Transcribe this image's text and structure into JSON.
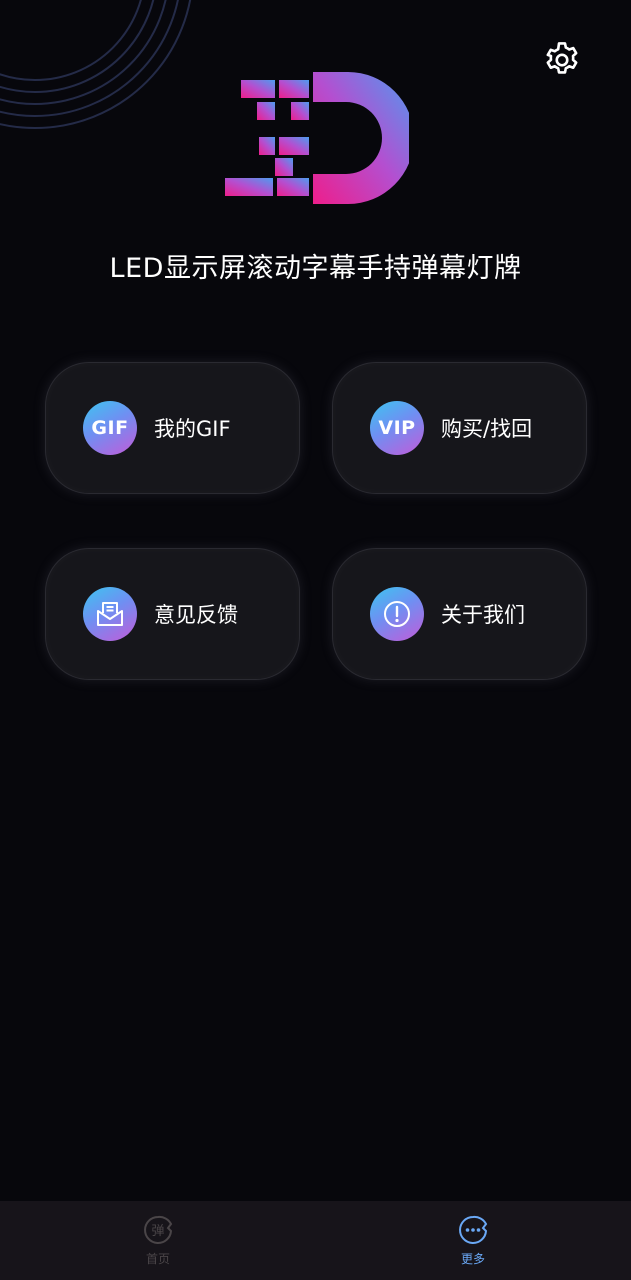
{
  "app": {
    "title": "LED显示屏滚动字幕手持弹幕灯牌"
  },
  "header": {
    "settings_icon": "gear-icon"
  },
  "menu": {
    "items": [
      {
        "id": "gif",
        "badge": "GIF",
        "label": "我的GIF",
        "icon": "gif-badge-icon"
      },
      {
        "id": "vip",
        "badge": "VIP",
        "label": "购买/找回",
        "icon": "vip-badge-icon"
      },
      {
        "id": "feedback",
        "label": "意见反馈",
        "icon": "mail-icon"
      },
      {
        "id": "about",
        "label": "关于我们",
        "icon": "info-icon"
      }
    ]
  },
  "tabbar": {
    "items": [
      {
        "id": "home",
        "label": "首页",
        "glyph": "弹",
        "active": false
      },
      {
        "id": "more",
        "label": "更多",
        "glyph": "…",
        "active": true
      }
    ]
  },
  "colors": {
    "background": "#07070c",
    "card": "#16161b",
    "accent_blue": "#3cc6f0",
    "accent_purple": "#c35bd9",
    "logo_pink": "#e91e8c",
    "active_tab": "#6aa8f5"
  }
}
